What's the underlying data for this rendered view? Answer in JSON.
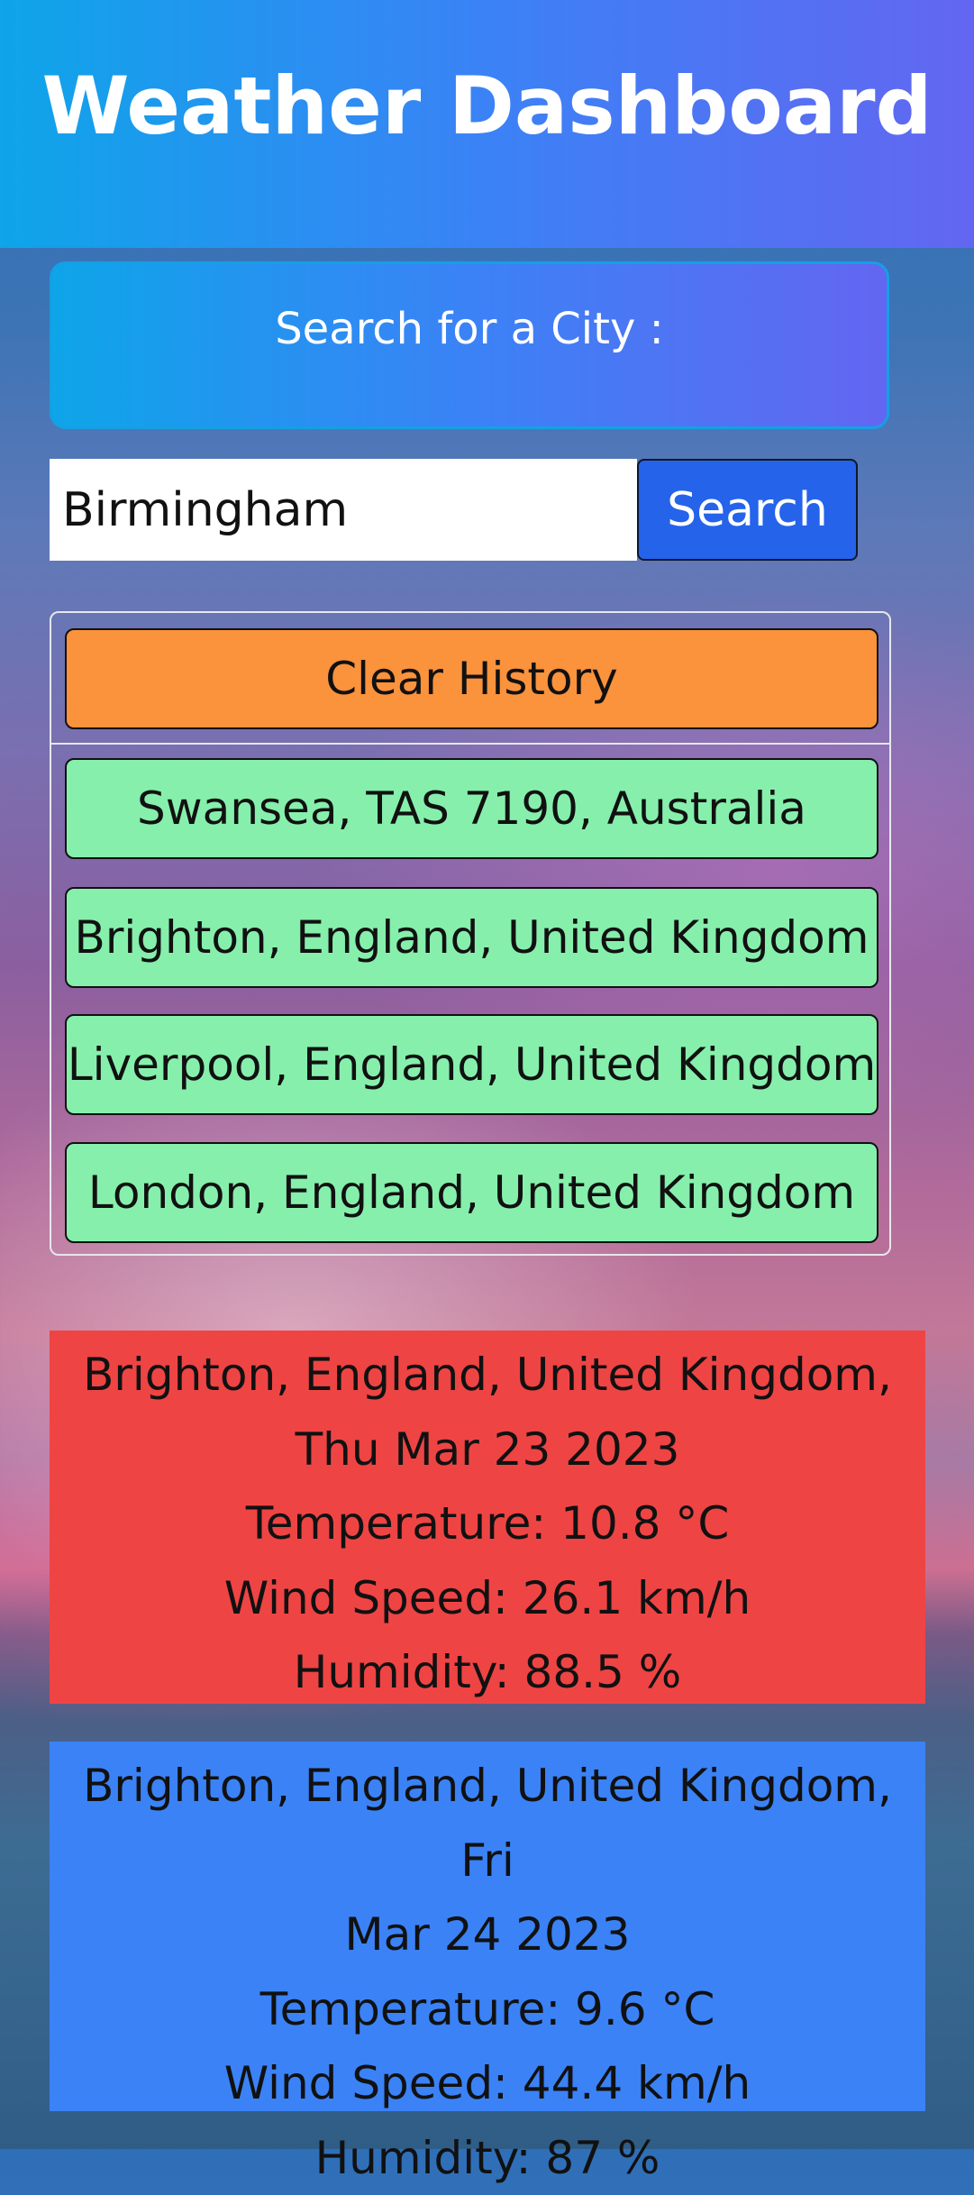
{
  "header": {
    "title": "Weather Dashboard"
  },
  "search": {
    "label": "Search for a City :",
    "input_value": "Birmingham",
    "button_label": "Search"
  },
  "history": {
    "clear_label": "Clear History",
    "cities": [
      "Swansea, TAS 7190, Australia",
      "Brighton, England, United Kingdom",
      "Liverpool, England, United Kingdom",
      "London, England, United Kingdom"
    ]
  },
  "forecast": [
    {
      "title": "Brighton, England, United Kingdom, Thu Mar 23 2023",
      "title_line1": "Brighton, England, United Kingdom,",
      "title_line2": "Thu Mar 23 2023",
      "temperature": "Temperature: 10.8 °C",
      "wind": "Wind Speed: 26.1 km/h",
      "humidity": "Humidity: 88.5 %",
      "color": "#ef4444"
    },
    {
      "title": "Brighton, England, United Kingdom, Fri Mar 24 2023",
      "title_line1": "Brighton, England, United Kingdom, Fri",
      "title_line2": "Mar 24 2023",
      "temperature": "Temperature: 9.6 °C",
      "wind": "Wind Speed: 44.4 km/h",
      "humidity": "Humidity: 87 %",
      "color": "#3b82f6"
    }
  ],
  "colors": {
    "header_gradient_start": "#0ea5e9",
    "header_gradient_end": "#6366f1",
    "search_button": "#2563eb",
    "clear_button": "#fb923c",
    "city_button": "#86efac"
  }
}
